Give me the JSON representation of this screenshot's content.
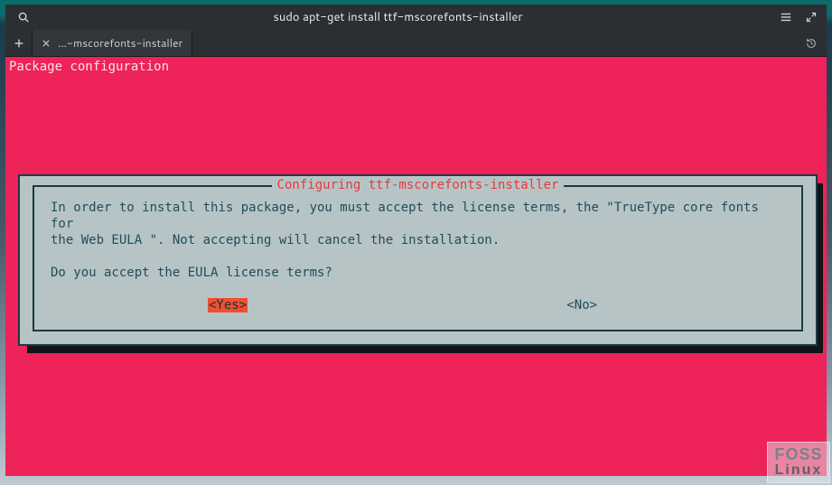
{
  "titlebar": {
    "title": "sudo apt-get install ttf-mscorefonts-installer"
  },
  "tabs": {
    "active_label": "...-mscorefonts-installer"
  },
  "terminal": {
    "header_label": "Package configuration"
  },
  "dialog": {
    "title": " Configuring ttf-mscorefonts-installer ",
    "line1": "In order to install this package, you must accept the license terms, the \"TrueType core fonts for",
    "line2": "the Web EULA \". Not accepting will cancel the installation.",
    "question": "Do you accept the EULA license terms?",
    "yes_label": "<Yes>",
    "no_label": "<No>"
  },
  "watermark": {
    "line1": "FOSS",
    "line2": "Linux"
  }
}
